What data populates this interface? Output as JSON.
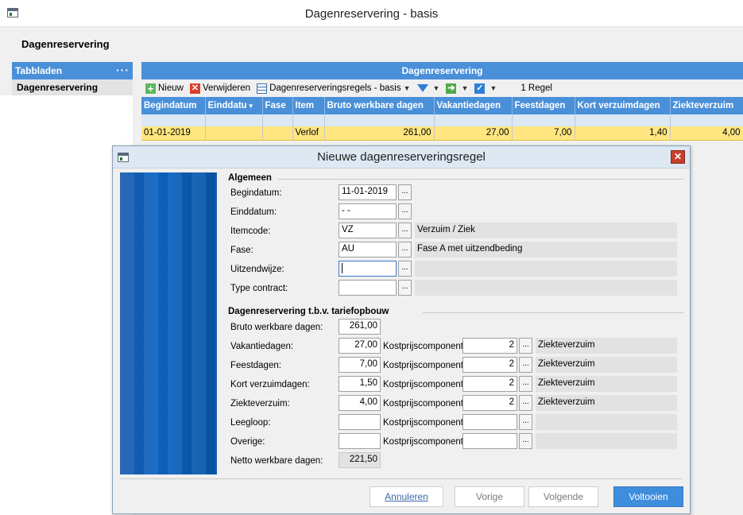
{
  "window": {
    "title": "Dagenreservering - basis"
  },
  "page": {
    "heading": "Dagenreservering"
  },
  "left_panel": {
    "header": "Tabbladen",
    "more": "···",
    "items": [
      "Dagenreservering"
    ]
  },
  "grid": {
    "title": "Dagenreservering",
    "toolbar": {
      "new_label": "Nieuw",
      "delete_label": "Verwijderen",
      "view_label": "Dagenreserveringsregels - basis",
      "count_label": "1 Regel"
    },
    "columns": [
      "Begindatum",
      "Einddatu",
      "Fase",
      "Item",
      "Bruto werkbare dagen",
      "Vakantiedagen",
      "Feestdagen",
      "Kort verzuimdagen",
      "Ziekteverzuim"
    ],
    "rows": [
      [
        "01-01-2019",
        "",
        "",
        "Verlof",
        "261,00",
        "27,00",
        "7,00",
        "1,40",
        "4,00"
      ]
    ]
  },
  "dialog": {
    "title": "Nieuwe dagenreserveringsregel",
    "section_general": "Algemeen",
    "section_rates": "Dagenreservering t.b.v. tariefopbouw",
    "general_fields": [
      {
        "label": "Begindatum:",
        "value": "11-01-2019",
        "desc": null
      },
      {
        "label": "Einddatum:",
        "value": " -  -",
        "desc": null
      },
      {
        "label": "Itemcode:",
        "value": "VZ",
        "desc": "Verzuim / Ziek"
      },
      {
        "label": "Fase:",
        "value": "AU",
        "desc": "Fase A met uitzendbeding"
      },
      {
        "label": "Uitzendwijze:",
        "value": "",
        "desc": "",
        "focused": true
      },
      {
        "label": "Type contract:",
        "value": "",
        "desc": ""
      }
    ],
    "gross_days": {
      "label": "Bruto werkbare dagen:",
      "value": "261,00"
    },
    "cost_component_label": "Kostprijscomponent:",
    "rate_fields": [
      {
        "label": "Vakantiedagen:",
        "value": "27,00",
        "component": "2",
        "component_desc": "Ziekteverzuim"
      },
      {
        "label": "Feestdagen:",
        "value": "7,00",
        "component": "2",
        "component_desc": "Ziekteverzuim"
      },
      {
        "label": "Kort verzuimdagen:",
        "value": "1,50",
        "component": "2",
        "component_desc": "Ziekteverzuim"
      },
      {
        "label": "Ziekteverzuim:",
        "value": "4,00",
        "component": "2",
        "component_desc": "Ziekteverzuim"
      },
      {
        "label": "Leegloop:",
        "value": "",
        "component": "",
        "component_desc": ""
      },
      {
        "label": "Overige:",
        "value": "",
        "component": "",
        "component_desc": ""
      }
    ],
    "net_days": {
      "label": "Netto werkbare dagen:",
      "value": "221,50"
    },
    "buttons": {
      "cancel": "Annuleren",
      "previous": "Vorige",
      "next": "Volgende",
      "finish": "Voltooien"
    },
    "close_glyph": "✕"
  },
  "colors": {
    "accent_blue": "#4a90d9",
    "selected_row": "#ffe680",
    "primary_button": "#3f8ede",
    "close_red": "#c7402b"
  },
  "icons": [
    "window-icon",
    "plus-icon",
    "delete-icon",
    "grid-view-icon",
    "filter-icon",
    "export-arrow-icon",
    "checkbox-icon",
    "close-icon"
  ]
}
